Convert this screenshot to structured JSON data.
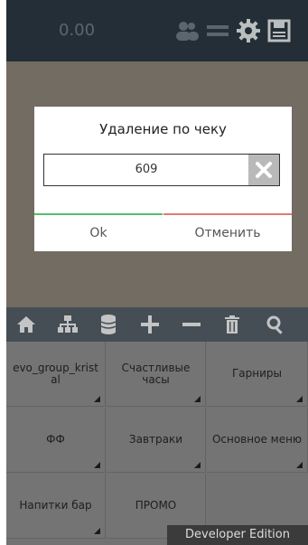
{
  "topbar": {
    "amount": "0.00",
    "icons": [
      "users-icon",
      "menu-icon",
      "gear-icon",
      "save-icon"
    ]
  },
  "toolbar": {
    "icons": [
      "home-icon",
      "hierarchy-icon",
      "database-icon",
      "plus-icon",
      "minus-icon",
      "trash-icon",
      "search-icon"
    ]
  },
  "grid": {
    "cells": [
      "evo_group_kristal",
      "Счастливые часы",
      "Гарниры",
      "ФФ",
      "Завтраки",
      "Основное меню",
      "Напитки бар",
      "ПРОМО"
    ]
  },
  "dialog": {
    "title": "Удаление по чеку",
    "input_value": "609",
    "ok_label": "Ok",
    "cancel_label": "Отменить"
  },
  "watermark": "Developer Edition",
  "colors": {
    "topbar_bg": "#2b3942",
    "toolbar_bg": "#556067",
    "ok_accent": "#55c06f",
    "cancel_accent": "#e07a74"
  }
}
